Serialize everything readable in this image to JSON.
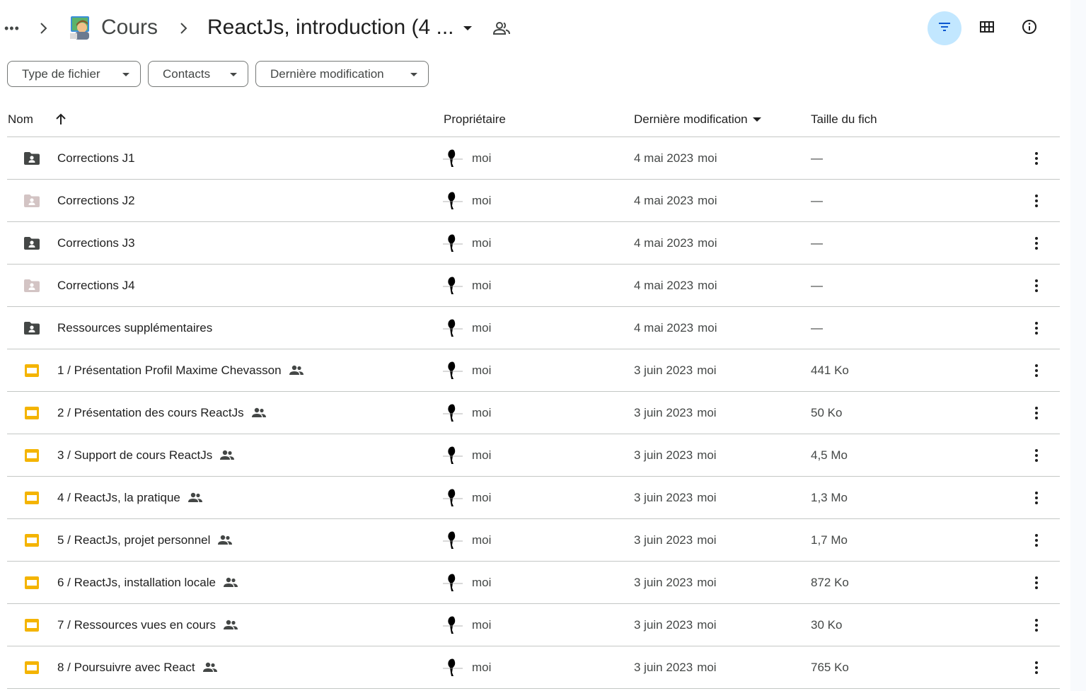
{
  "header": {
    "more_label": "•••",
    "breadcrumb_parent": "Cours",
    "breadcrumb_current": "ReactJs, introduction (4 ..."
  },
  "toolbar": {
    "filter_icon": "filter-icon",
    "grid_icon": "grid-view-icon",
    "info_icon": "info-icon",
    "accent_color": "#c2e7ff"
  },
  "filters": [
    {
      "label": "Type de fichier"
    },
    {
      "label": "Contacts"
    },
    {
      "label": "Dernière modification"
    }
  ],
  "columns": {
    "name": "Nom",
    "owner": "Propriétaire",
    "modified": "Dernière modification",
    "size": "Taille du fich"
  },
  "rows": [
    {
      "name": "Corrections J1",
      "type": "folder-shared",
      "folder_color": "#444746",
      "owner": "moi",
      "modified": "4 mai 2023",
      "modified_by": "moi",
      "size": "—",
      "shared": false
    },
    {
      "name": "Corrections J2",
      "type": "folder-shared",
      "folder_color": "#d3c4c4",
      "owner": "moi",
      "modified": "4 mai 2023",
      "modified_by": "moi",
      "size": "—",
      "shared": false
    },
    {
      "name": "Corrections J3",
      "type": "folder-shared",
      "folder_color": "#444746",
      "owner": "moi",
      "modified": "4 mai 2023",
      "modified_by": "moi",
      "size": "—",
      "shared": false
    },
    {
      "name": "Corrections J4",
      "type": "folder-shared",
      "folder_color": "#d3c4c4",
      "owner": "moi",
      "modified": "4 mai 2023",
      "modified_by": "moi",
      "size": "—",
      "shared": false
    },
    {
      "name": "Ressources supplémentaires",
      "type": "folder-shared",
      "folder_color": "#444746",
      "owner": "moi",
      "modified": "4 mai 2023",
      "modified_by": "moi",
      "size": "—",
      "shared": false
    },
    {
      "name": "1 / Présentation Profil Maxime Chevasson",
      "type": "slides",
      "owner": "moi",
      "modified": "3 juin 2023",
      "modified_by": "moi",
      "size": "441 Ko",
      "shared": true
    },
    {
      "name": "2 / Présentation des cours ReactJs",
      "type": "slides",
      "owner": "moi",
      "modified": "3 juin 2023",
      "modified_by": "moi",
      "size": "50 Ko",
      "shared": true
    },
    {
      "name": "3 / Support de cours ReactJs",
      "type": "slides",
      "owner": "moi",
      "modified": "3 juin 2023",
      "modified_by": "moi",
      "size": "4,5 Mo",
      "shared": true
    },
    {
      "name": "4 / ReactJs, la pratique",
      "type": "slides",
      "owner": "moi",
      "modified": "3 juin 2023",
      "modified_by": "moi",
      "size": "1,3 Mo",
      "shared": true
    },
    {
      "name": "5 / ReactJs, projet personnel",
      "type": "slides",
      "owner": "moi",
      "modified": "3 juin 2023",
      "modified_by": "moi",
      "size": "1,7 Mo",
      "shared": true
    },
    {
      "name": "6 / ReactJs, installation locale",
      "type": "slides",
      "owner": "moi",
      "modified": "3 juin 2023",
      "modified_by": "moi",
      "size": "872 Ko",
      "shared": true
    },
    {
      "name": "7 / Ressources vues en cours",
      "type": "slides",
      "owner": "moi",
      "modified": "3 juin 2023",
      "modified_by": "moi",
      "size": "30 Ko",
      "shared": true
    },
    {
      "name": "8 / Poursuivre avec React",
      "type": "slides",
      "owner": "moi",
      "modified": "3 juin 2023",
      "modified_by": "moi",
      "size": "765 Ko",
      "shared": true
    }
  ],
  "colors": {
    "slides_yellow": "#f4b400",
    "divider": "#c4c7c5",
    "secondary_text": "#444746"
  }
}
